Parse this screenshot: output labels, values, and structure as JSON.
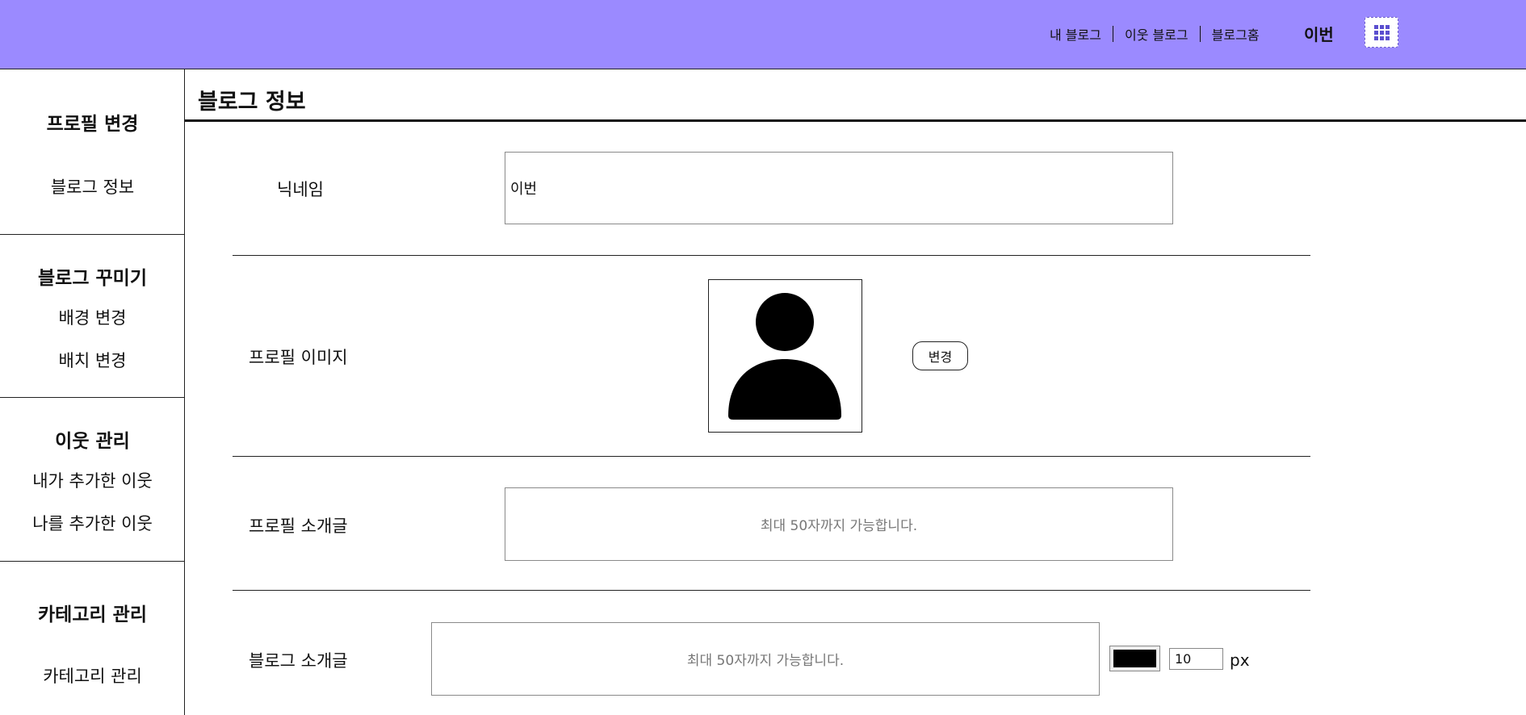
{
  "header": {
    "nav": [
      "내 블로그",
      "이웃 블로그",
      "블로그홈"
    ],
    "username": "이번",
    "apps_icon": "grid-icon",
    "bg_color": "#9b8aff"
  },
  "sidebar": {
    "sections": [
      {
        "title": "프로필 변경",
        "items": [
          "블로그 정보"
        ]
      },
      {
        "title": "블로그 꾸미기",
        "items": [
          "배경 변경",
          "배치 변경"
        ]
      },
      {
        "title": "이웃 관리",
        "items": [
          "내가 추가한 이웃",
          "나를 추가한 이웃"
        ]
      },
      {
        "title": "카테고리 관리",
        "items": [
          "카테고리 관리"
        ]
      }
    ]
  },
  "main": {
    "title": "블로그 정보",
    "nickname": {
      "label": "닉네임",
      "value": "이번"
    },
    "profile_image": {
      "label": "프로필 이미지",
      "icon": "user-avatar-icon",
      "button": "변경"
    },
    "profile_intro": {
      "label": "프로필 소개글",
      "placeholder": "최대 50자까지 가능합니다."
    },
    "blog_intro": {
      "label": "블로그 소개글",
      "placeholder": "최대 50자까지 가능합니다.",
      "color": "#000000",
      "font_size": "10",
      "unit": "px"
    }
  }
}
